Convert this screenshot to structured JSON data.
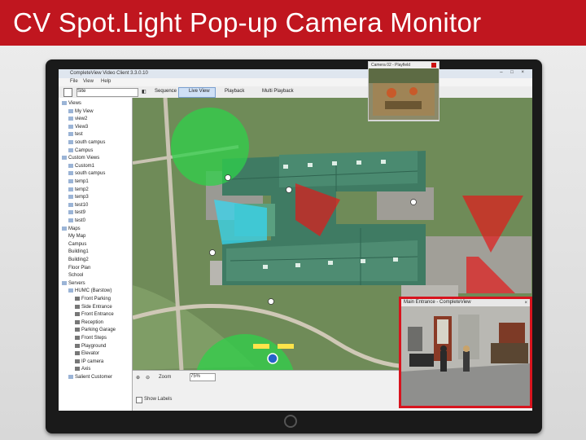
{
  "slide": {
    "title": "CV Spot.Light Pop-up Camera Monitor"
  },
  "window": {
    "title": "CompleteView Video Client 3.3.0.10",
    "controls": "–  □  ×"
  },
  "menu": [
    "File",
    "View",
    "Help"
  ],
  "toolbar": {
    "site": "Site",
    "sequence": "Sequence",
    "live_view": "Live View",
    "playback": "Playback",
    "multi_playback": "Multi Playback"
  },
  "tree": [
    {
      "label": "Views",
      "type": "folder",
      "depth": 0
    },
    {
      "label": "My View",
      "type": "view",
      "depth": 1
    },
    {
      "label": "view2",
      "type": "view",
      "depth": 1
    },
    {
      "label": "View3",
      "type": "view",
      "depth": 1
    },
    {
      "label": "test",
      "type": "view",
      "depth": 1
    },
    {
      "label": "south campus",
      "type": "view",
      "depth": 1
    },
    {
      "label": "Campus",
      "type": "view",
      "depth": 1
    },
    {
      "label": "Custom Views",
      "type": "folder",
      "depth": 0
    },
    {
      "label": "Custom1",
      "type": "view",
      "depth": 1
    },
    {
      "label": "south campus",
      "type": "view",
      "depth": 1
    },
    {
      "label": "temp1",
      "type": "view",
      "depth": 1
    },
    {
      "label": "temp2",
      "type": "view",
      "depth": 1
    },
    {
      "label": "temp3",
      "type": "view",
      "depth": 1
    },
    {
      "label": "test10",
      "type": "view",
      "depth": 1
    },
    {
      "label": "test9",
      "type": "view",
      "depth": 1
    },
    {
      "label": "test0",
      "type": "view",
      "depth": 1
    },
    {
      "label": "Maps",
      "type": "folder",
      "depth": 0
    },
    {
      "label": "My Map",
      "type": "map",
      "depth": 1
    },
    {
      "label": "Campus",
      "type": "map",
      "depth": 1
    },
    {
      "label": "Building1",
      "type": "map",
      "depth": 1
    },
    {
      "label": "Building2",
      "type": "map",
      "depth": 1
    },
    {
      "label": "Floor Plan",
      "type": "map",
      "depth": 1
    },
    {
      "label": "School",
      "type": "map",
      "depth": 1
    },
    {
      "label": "Servers",
      "type": "folder",
      "depth": 0
    },
    {
      "label": "HUMC (Barstow)",
      "type": "folder",
      "depth": 1
    },
    {
      "label": "Front Parking",
      "type": "camera",
      "depth": 2
    },
    {
      "label": "Side Entrance",
      "type": "camera",
      "depth": 2
    },
    {
      "label": "Front Entrance",
      "type": "camera",
      "depth": 2
    },
    {
      "label": "Reception",
      "type": "camera",
      "depth": 2
    },
    {
      "label": "Parking Garage",
      "type": "camera",
      "depth": 2
    },
    {
      "label": "Front Steps",
      "type": "camera",
      "depth": 2
    },
    {
      "label": "Playground",
      "type": "camera",
      "depth": 2
    },
    {
      "label": "Elevator",
      "type": "camera",
      "depth": 2
    },
    {
      "label": "IP camera",
      "type": "camera",
      "depth": 2
    },
    {
      "label": "Axis",
      "type": "camera",
      "depth": 2
    },
    {
      "label": "Salient Customer",
      "type": "folder",
      "depth": 1
    }
  ],
  "map_bottom": {
    "zoom_label": "Zoom",
    "zoom_value": "75%",
    "show_labels": "Show Labels"
  },
  "popups": {
    "small_title": "Camera 02 - Playfield",
    "main_title": "Main Entrance - CompleteView",
    "close": "×"
  },
  "colors": {
    "title_bar": "#c0161f",
    "popup_border": "#d8141e",
    "coverage_green": "#2fd04a",
    "coverage_red": "#e21a1a",
    "coverage_cyan": "#38d5f0"
  }
}
